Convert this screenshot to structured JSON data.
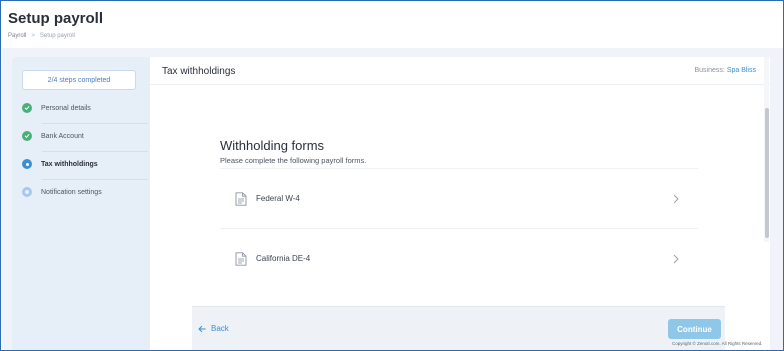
{
  "header": {
    "title": "Setup payroll",
    "breadcrumb": {
      "root": "Payroll",
      "separator": ">",
      "current": "Setup payroll"
    }
  },
  "sidebar": {
    "progress": "2/4 steps completed",
    "steps": [
      {
        "label": "Personal details",
        "state": "completed"
      },
      {
        "label": "Bank Account",
        "state": "completed"
      },
      {
        "label": "Tax withholdings",
        "state": "active"
      },
      {
        "label": "Notification settings",
        "state": "pending"
      }
    ]
  },
  "content": {
    "title": "Tax withholdings",
    "business_label": "Business:",
    "business_name": "Spa Bliss",
    "forms_title": "Withholding forms",
    "forms_subtitle": "Please complete the following payroll forms.",
    "forms": [
      {
        "name": "Federal W-4",
        "icon": "document-icon"
      },
      {
        "name": "California DE-4",
        "icon": "document-icon"
      }
    ]
  },
  "footer": {
    "back_label": "Back",
    "continue_label": "Continue"
  },
  "copyright": "Copyright © Zenoti.com. All Rights Reserved.",
  "colors": {
    "accent": "#3a8fd4",
    "success": "#49b07a",
    "continue_disabled": "#8ec7ea",
    "sidebar_bg": "#e6eef8"
  }
}
